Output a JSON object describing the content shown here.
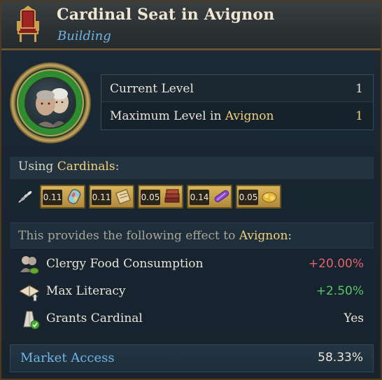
{
  "header": {
    "title": "Cardinal Seat in Avignon",
    "subtitle": "Building",
    "icon": "throne-icon"
  },
  "portrait": {
    "icon": "cardinals-portrait",
    "ring_color": "#2c8a30"
  },
  "levels": {
    "current_label": "Current Level",
    "current_value": "1",
    "max_label_prefix": "Maximum Level in ",
    "max_label_location": "Avignon",
    "max_value": "1"
  },
  "using": {
    "prefix": "Using ",
    "pop_type": "Cardinals",
    "suffix": ":",
    "lead_icon": "wheat-icon",
    "goods": [
      {
        "amount": "0.11",
        "icon": "stained-glass-icon"
      },
      {
        "amount": "0.11",
        "icon": "scroll-icon"
      },
      {
        "amount": "0.05",
        "icon": "books-icon"
      },
      {
        "amount": "0.14",
        "icon": "silk-icon"
      },
      {
        "amount": "0.05",
        "icon": "jewelry-icon"
      }
    ]
  },
  "effects": {
    "header_prefix": "This provides the following effect to ",
    "header_location": "Avignon",
    "header_suffix": ":",
    "rows": [
      {
        "label": "Clergy Food Consumption",
        "value": "+20.00%",
        "icon": "clergy-food-icon",
        "tone": "negative"
      },
      {
        "label": "Max Literacy",
        "value": "+2.50%",
        "icon": "literacy-icon",
        "tone": "positive"
      },
      {
        "label": "Grants Cardinal",
        "value": "Yes",
        "icon": "cardinal-hat-icon",
        "tone": "neutral"
      }
    ]
  },
  "market": {
    "label": "Market Access",
    "value": "58.33%"
  },
  "colors": {
    "gold_text": "#f1d27a",
    "blue_text": "#6fb4e6",
    "negative": "#e2646a",
    "positive": "#59c565"
  }
}
